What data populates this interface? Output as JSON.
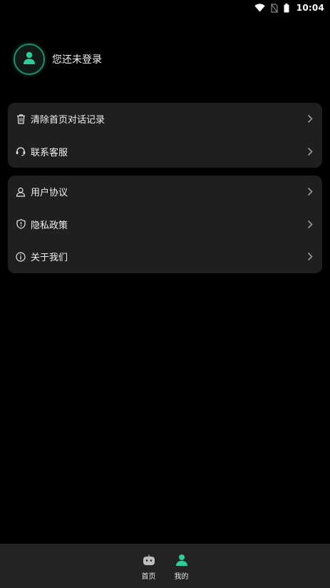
{
  "status_bar": {
    "time": "10:04",
    "icons": [
      "wifi-icon",
      "no-sim-icon",
      "battery-icon"
    ]
  },
  "profile": {
    "name": "您还未登录",
    "avatar_icon": "user-icon",
    "accent_color": "#2ecc9a"
  },
  "menu_groups": [
    {
      "items": [
        {
          "label": "清除首页对话记录",
          "icon": "trash-icon"
        },
        {
          "label": "联系客服",
          "icon": "headset-icon"
        }
      ]
    },
    {
      "items": [
        {
          "label": "用户协议",
          "icon": "user-agreement-icon"
        },
        {
          "label": "隐私政策",
          "icon": "shield-icon"
        },
        {
          "label": "关于我们",
          "icon": "info-icon"
        }
      ]
    }
  ],
  "bottom_nav": {
    "items": [
      {
        "label": "首页",
        "icon": "robot-icon",
        "active": false
      },
      {
        "label": "我的",
        "icon": "user-icon",
        "active": true
      }
    ]
  },
  "colors": {
    "background": "#000000",
    "card": "#1f1f1f",
    "nav_bar": "#232323",
    "accent": "#2ecc9a"
  }
}
